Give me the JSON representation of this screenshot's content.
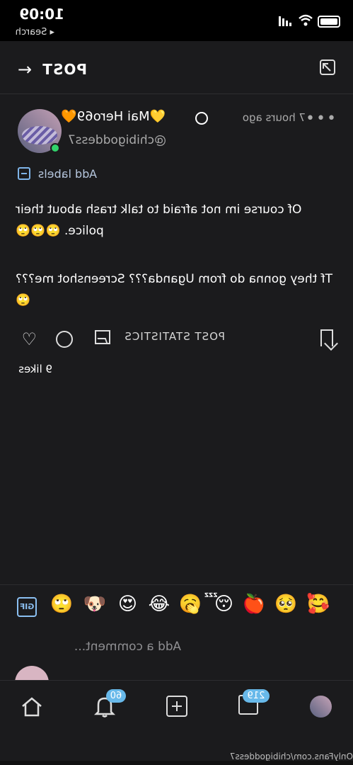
{
  "status": {
    "time": "10:09",
    "back_app": "◂ Search"
  },
  "header": {
    "title": "POST"
  },
  "post": {
    "display_name": "💛Mai Hero69🧡",
    "username": "@chibigoddess7",
    "time_ago": "7 hours ago",
    "labels": "Add labels",
    "paragraphs": [
      "Of course im not afraid to talk trash about their police. 🙄🙄🙄",
      "Tf they gonna do from Uganda??? Screenshot me??? 🙄"
    ],
    "stats_label": "POST STATISTICS",
    "likes": "9 likes"
  },
  "comment": {
    "placeholder": "Add a comment...",
    "gif": "GIF",
    "emojis": [
      "🙄",
      "🐶",
      "😍",
      "😂",
      "🥱",
      "😴",
      "🍎",
      "🥺",
      "🥰"
    ]
  },
  "nav": {
    "messages_badge": "219",
    "notifications_badge": "60"
  },
  "footer": {
    "url": "OnlyFans.com/chibigoddess7"
  },
  "colors": {
    "background": "#1b1b1d",
    "accent": "#68b9ea",
    "online": "#31d26b"
  }
}
